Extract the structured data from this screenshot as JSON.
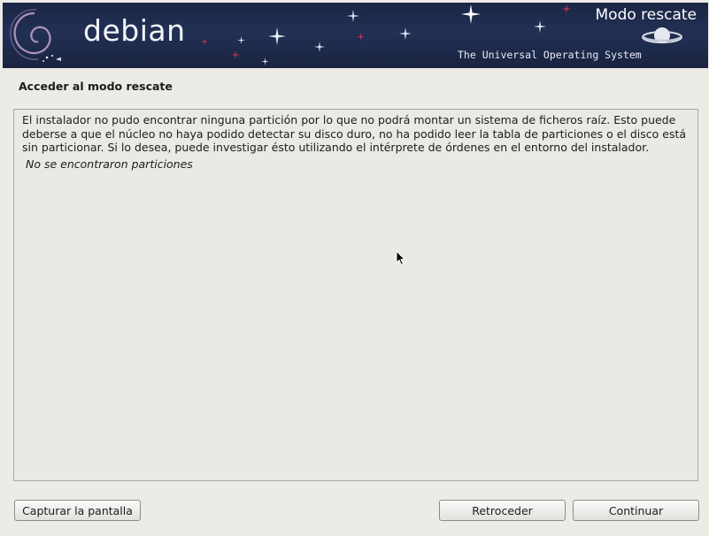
{
  "banner": {
    "logo_text": "debian",
    "title": "Modo rescate",
    "tagline": "The Universal Operating System"
  },
  "page": {
    "heading": "Acceder al modo rescate",
    "message": "El instalador no pudo encontrar ninguna partición por lo que no podrá montar un sistema de ficheros raíz. Esto puede deberse a que el núcleo no haya podido detectar su disco duro, no ha podido leer la tabla de particiones o el disco está sin particionar. Si lo desea, puede investigar ésto utilizando el intérprete de órdenes en el entorno del instalador.",
    "note": "No se encontraron particiones"
  },
  "buttons": {
    "screenshot": "Capturar la pantalla",
    "back": "Retroceder",
    "continue": "Continuar"
  },
  "colors": {
    "banner_bg": "#1b2645",
    "window_bg": "#edebe6",
    "accent_red": "#d70751"
  }
}
